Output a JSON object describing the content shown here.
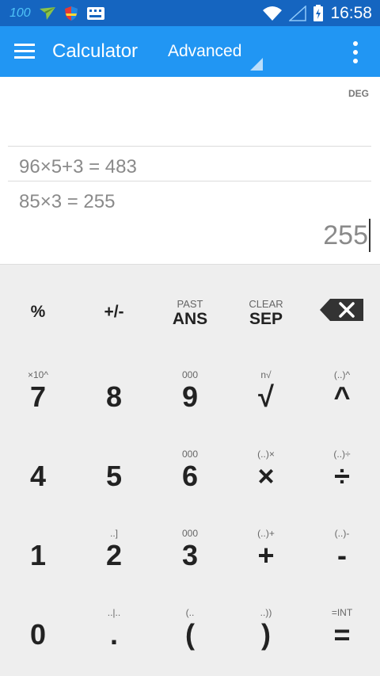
{
  "status_bar": {
    "battery_level": "100",
    "time": "16:58",
    "icons": [
      "paper-plane-icon",
      "shield-icon",
      "keyboard-icon",
      "wifi-icon",
      "signal-icon",
      "battery-icon"
    ]
  },
  "app_bar": {
    "title": "Calculator",
    "mode": "Advanced",
    "menu_icon": "hamburger-menu-icon",
    "overflow_icon": "more-vert-icon"
  },
  "display": {
    "angle_mode": "DEG",
    "history": [
      "96×5+3 = 483",
      "85×3 = 255"
    ],
    "current": "255"
  },
  "keypad": {
    "rows": [
      [
        {
          "name": "percent",
          "primary": "%",
          "secondary": ""
        },
        {
          "name": "plus-minus",
          "primary": "+/-",
          "secondary": ""
        },
        {
          "name": "ans",
          "primary": "ANS",
          "secondary": "PAST"
        },
        {
          "name": "sep",
          "primary": "SEP",
          "secondary": "CLEAR"
        },
        {
          "name": "backspace",
          "primary": "",
          "secondary": "",
          "icon": "backspace-icon"
        }
      ],
      [
        {
          "name": "7",
          "primary": "7",
          "secondary": "×10^"
        },
        {
          "name": "8",
          "primary": "8",
          "secondary": ""
        },
        {
          "name": "9",
          "primary": "9",
          "secondary": "000"
        },
        {
          "name": "sqrt",
          "primary": "√",
          "secondary": "n√"
        },
        {
          "name": "power",
          "primary": "^",
          "secondary": "(..)^"
        }
      ],
      [
        {
          "name": "4",
          "primary": "4",
          "secondary": ""
        },
        {
          "name": "5",
          "primary": "5",
          "secondary": ""
        },
        {
          "name": "6",
          "primary": "6",
          "secondary": "000"
        },
        {
          "name": "multiply",
          "primary": "×",
          "secondary": "(..)×"
        },
        {
          "name": "divide",
          "primary": "÷",
          "secondary": "(..)÷"
        }
      ],
      [
        {
          "name": "1",
          "primary": "1",
          "secondary": ""
        },
        {
          "name": "2",
          "primary": "2",
          "secondary": "..]"
        },
        {
          "name": "3",
          "primary": "3",
          "secondary": "000"
        },
        {
          "name": "plus",
          "primary": "+",
          "secondary": "(..)+"
        },
        {
          "name": "minus",
          "primary": "-",
          "secondary": "(..)-"
        }
      ],
      [
        {
          "name": "0",
          "primary": "0",
          "secondary": ""
        },
        {
          "name": "decimal",
          "primary": ".",
          "secondary": "..|.."
        },
        {
          "name": "open-paren",
          "primary": "(",
          "secondary": "(.."
        },
        {
          "name": "close-paren",
          "primary": ")",
          "secondary": "..))"
        },
        {
          "name": "equals",
          "primary": "=",
          "secondary": "=INT"
        }
      ]
    ]
  },
  "colors": {
    "status_bar": "#1565c0",
    "app_bar": "#2196f3",
    "display_bg": "#ffffff",
    "keypad_bg": "#eeeeee",
    "history_text": "#8a8a8a",
    "key_text": "#222222"
  }
}
